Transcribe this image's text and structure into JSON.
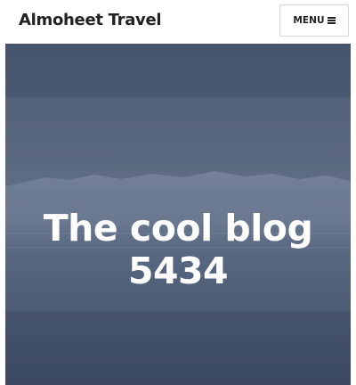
{
  "header": {
    "site_title": "Almoheet Travel",
    "menu_label": "MENU"
  },
  "hero": {
    "title_line1": "The cool blog",
    "title_line2": "5434",
    "image": "icy lake landscape with bluish fog"
  },
  "colors": {
    "header_bg": "#ffffff",
    "title_text": "#222222",
    "hero_tint": "#4f5f78",
    "hero_text": "#ffffff"
  },
  "icons": [
    "hamburger-icon"
  ]
}
